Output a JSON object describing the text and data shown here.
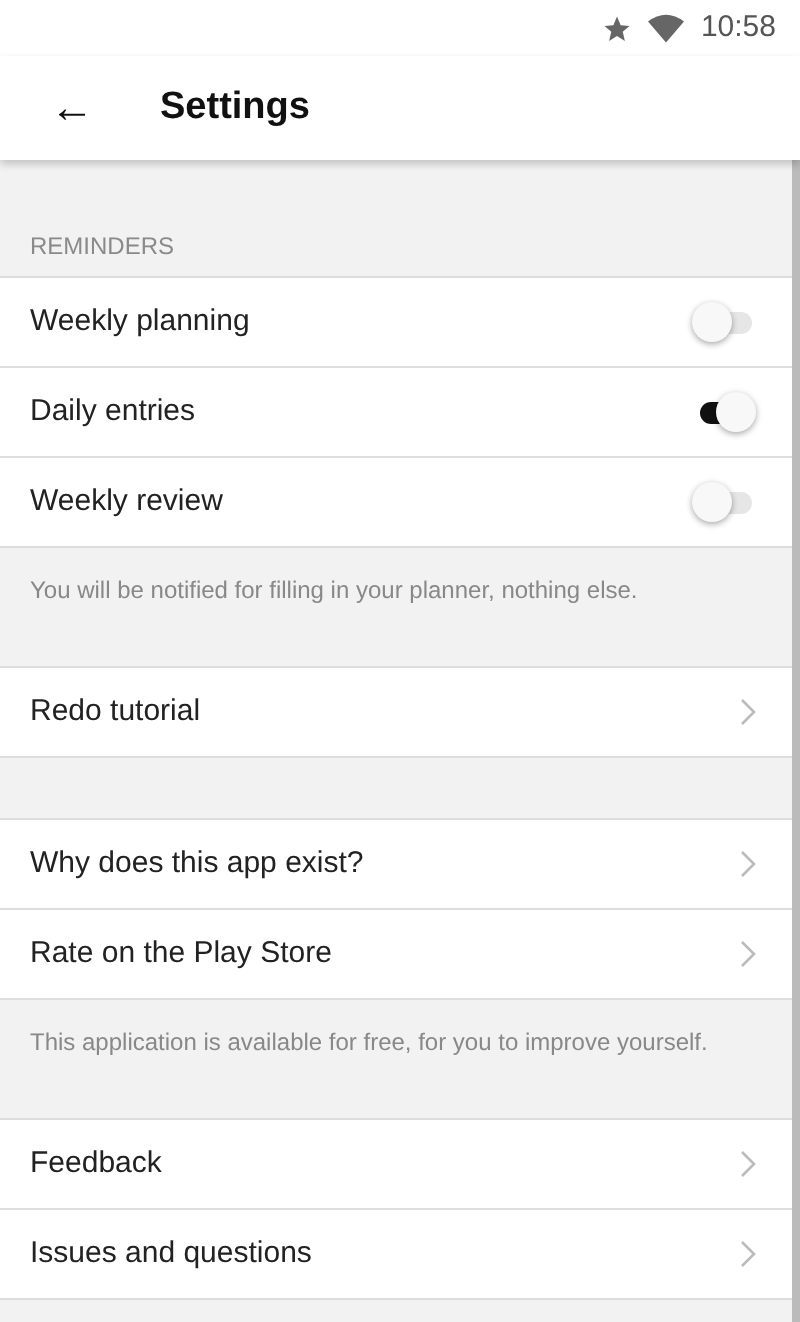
{
  "status_bar": {
    "time": "10:58"
  },
  "toolbar": {
    "back": "←",
    "title": "Settings"
  },
  "sections": [
    {
      "header": "REMINDERS",
      "items": [
        {
          "kind": "toggle",
          "label": "Weekly planning",
          "on": false
        },
        {
          "kind": "toggle",
          "label": "Daily entries",
          "on": true
        },
        {
          "kind": "toggle",
          "label": "Weekly review",
          "on": false
        }
      ],
      "note": "You will be notified for filling in your planner, nothing else."
    },
    {
      "items": [
        {
          "kind": "link",
          "label": "Redo tutorial"
        }
      ]
    },
    {
      "items": [
        {
          "kind": "link",
          "label": "Why does this app exist?"
        },
        {
          "kind": "link",
          "label": "Rate on the Play Store"
        }
      ],
      "note": "This application is available for free, for you to improve yourself."
    },
    {
      "items": [
        {
          "kind": "link",
          "label": "Feedback"
        },
        {
          "kind": "link",
          "label": "Issues and questions"
        }
      ]
    }
  ]
}
